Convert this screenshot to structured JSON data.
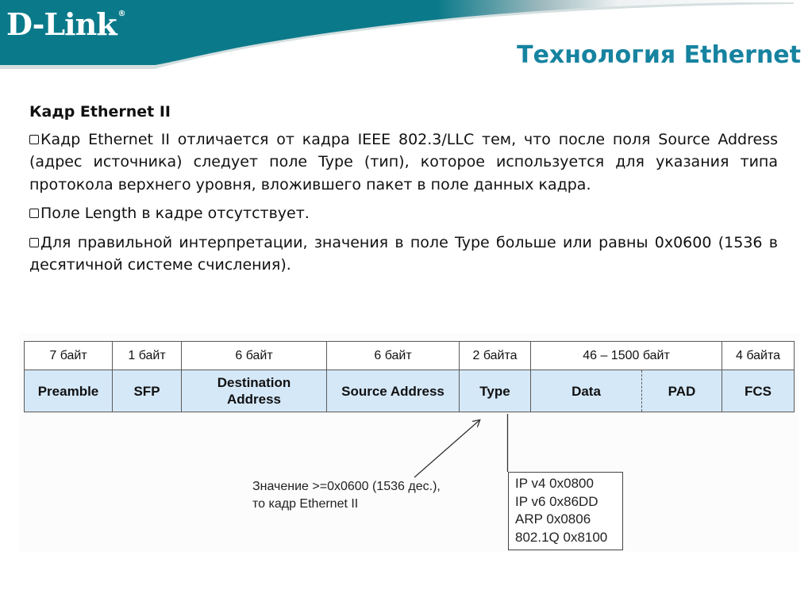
{
  "brand": {
    "logo_text": "D-Link",
    "registered_mark": "®",
    "teal_color": "#0a7a8a"
  },
  "title": "Технология Ethernet",
  "title_color": "#1683a0",
  "subheading": "Кадр Ethernet II",
  "bullets": [
    "Кадр Ethernet II отличается от кадра IEEE 802.3/LLC тем, что после поля Source Address (адрес источника) следует поле Type (тип), которое используется для указания типа протокола верхнего уровня, вложившего пакет в поле данных кадра.",
    "Поле Length в кадре отсутствует.",
    "Для правильной интерпретации, значения в поле Type больше или равны 0x0600 (1536 в десятичной системе счисления)."
  ],
  "frame": {
    "sizes": [
      "7 байт",
      "1 байт",
      "6 байт",
      "6 байт",
      "2 байта",
      "46 – 1500 байт",
      "4 байта"
    ],
    "fields": [
      "Preamble",
      "SFP",
      "Destination Address",
      "Source Address",
      "Type",
      "Data",
      "PAD",
      "FCS"
    ],
    "field_fill": "#d5e8f8"
  },
  "annotation": {
    "line1": "Значение >=0x0600 (1536 дес.),",
    "line2": "то кадр Ethernet II"
  },
  "ethertypes": [
    "IP v4 0x0800",
    "IP v6 0x86DD",
    "ARP 0x0806",
    "802.1Q 0x8100"
  ]
}
